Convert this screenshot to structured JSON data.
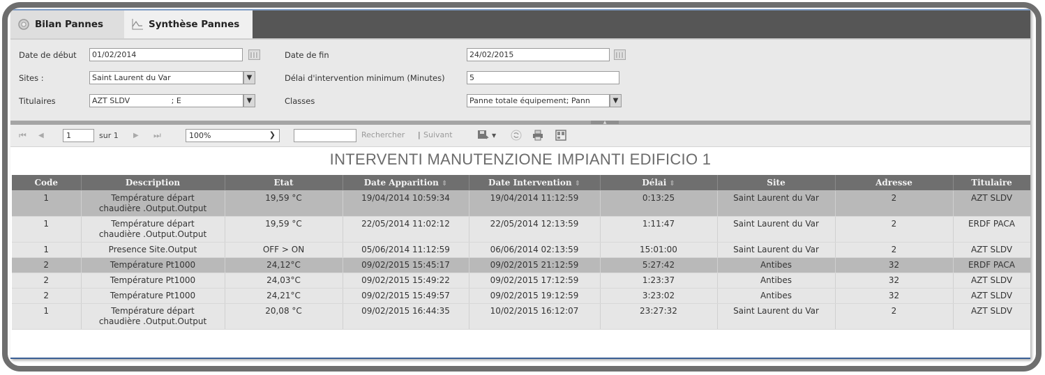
{
  "tabs": [
    {
      "label": "Bilan Pannes",
      "icon": "gear-icon",
      "active": false
    },
    {
      "label": "Synthèse Pannes",
      "icon": "chart-line-icon",
      "active": true
    }
  ],
  "filters": {
    "date_debut": {
      "label": "Date de début",
      "value": "01/02/2014"
    },
    "date_fin": {
      "label": "Date de fin",
      "value": "24/02/2015"
    },
    "sites": {
      "label": "Sites :",
      "value": "Saint Laurent du Var"
    },
    "delai": {
      "label": "Délai d'intervention minimum (Minutes)",
      "value": "5"
    },
    "titulaires": {
      "label": "Titulaires",
      "value": "AZT SLDV                 ; E"
    },
    "classes": {
      "label": "Classes",
      "value": "Panne totale équipement; Pann"
    }
  },
  "toolbar": {
    "first_page": "⏮",
    "prev_page": "◀",
    "page_value": "1",
    "page_of": "sur 1",
    "next_page": "▶",
    "last_page": "⏭",
    "zoom_value": "100%",
    "search_value": "",
    "search_label": "Rechercher",
    "separator": "|",
    "next_label": "Suivant"
  },
  "report": {
    "title": "INTERVENTI MANUTENZIONE IMPIANTI EDIFICIO 1",
    "columns": [
      "Code",
      "Description",
      "Etat",
      "Date Apparition",
      "Date Intervention",
      "Délai",
      "Site",
      "Adresse",
      "Titulaire"
    ],
    "sortable": [
      false,
      false,
      false,
      true,
      true,
      true,
      false,
      false,
      false
    ],
    "rows": [
      {
        "code": "1",
        "description": "Température départ chaudière .Output.Output",
        "etat": "19,59 °C",
        "date_apparition": "19/04/2014 10:59:34",
        "date_intervention": "19/04/2014 11:12:59",
        "delai": "0:13:25",
        "site": "Saint Laurent du Var",
        "adresse": "2",
        "titulaire": "AZT SLDV"
      },
      {
        "code": "1",
        "description": "Température départ chaudière .Output.Output",
        "etat": "19,59 °C",
        "date_apparition": "22/05/2014 11:02:12",
        "date_intervention": "22/05/2014 12:13:59",
        "delai": "1:11:47",
        "site": "Saint Laurent du Var",
        "adresse": "2",
        "titulaire": "ERDF PACA"
      },
      {
        "code": "1",
        "description": "Presence Site.Output",
        "etat": "OFF > ON",
        "date_apparition": "05/06/2014 11:12:59",
        "date_intervention": "06/06/2014 02:13:59",
        "delai": "15:01:00",
        "site": "Saint Laurent du Var",
        "adresse": "2",
        "titulaire": "AZT SLDV"
      },
      {
        "code": "2",
        "description": "Température Pt1000",
        "etat": "24,12°C",
        "date_apparition": "09/02/2015 15:45:17",
        "date_intervention": "09/02/2015 21:12:59",
        "delai": "5:27:42",
        "site": "Antibes",
        "adresse": "32",
        "titulaire": "ERDF PACA"
      },
      {
        "code": "2",
        "description": "Température Pt1000",
        "etat": "24,03°C",
        "date_apparition": "09/02/2015 15:49:22",
        "date_intervention": "09/02/2015 17:12:59",
        "delai": "1:23:37",
        "site": "Antibes",
        "adresse": "32",
        "titulaire": "AZT SLDV"
      },
      {
        "code": "2",
        "description": "Température Pt1000",
        "etat": "24,21°C",
        "date_apparition": "09/02/2015 15:49:57",
        "date_intervention": "09/02/2015 19:12:59",
        "delai": "3:23:02",
        "site": "Antibes",
        "adresse": "32",
        "titulaire": "AZT SLDV"
      },
      {
        "code": "1",
        "description": "Température départ chaudière .Output.Output",
        "etat": "20,08 °C",
        "date_apparition": "09/02/2015 16:44:35",
        "date_intervention": "10/02/2015 16:12:07",
        "delai": "23:27:32",
        "site": "Saint Laurent du Var",
        "adresse": "2",
        "titulaire": "AZT SLDV"
      }
    ]
  }
}
